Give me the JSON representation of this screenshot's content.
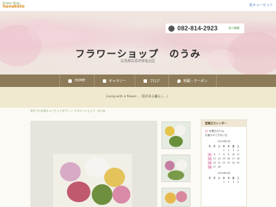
{
  "header": {
    "logo_top": "Flower Shop",
    "logo_brand": "hanakoto",
    "brand_right": "花キューピット",
    "tel": "082-814-2923",
    "recruit_label": "求人情報"
  },
  "hero": {
    "title": "フラワーショップ　のうみ",
    "subtitle": "広島県広島市安佐北区"
  },
  "nav": {
    "items": [
      {
        "label": "HOME",
        "icon": "home-icon"
      },
      {
        "label": "ギャラリー",
        "icon": "camera-icon"
      },
      {
        "label": "ブログ",
        "icon": "pencil-icon"
      },
      {
        "label": "地図・クーポン",
        "icon": "map-pin-icon"
      }
    ]
  },
  "tagline": "Living with a flower...（花のある暮らし...）",
  "breadcrumb": "花ギフトの花キューピットタウン ＞ フラワーショップ　のうみ",
  "calendar": {
    "title": "営業日カレンダー",
    "legend_holiday": "休業日または",
    "legend_note": "お届けのできない日",
    "month1": "2023年2月",
    "month2": "2023年3月",
    "dow": [
      "日",
      "月",
      "火",
      "水",
      "木",
      "金",
      "土"
    ],
    "feb": [
      "",
      "",
      "",
      "1",
      "2",
      "3",
      "4",
      "5",
      "6",
      "7",
      "8",
      "9",
      "10",
      "11",
      "12",
      "13",
      "14",
      "15",
      "16",
      "17",
      "18",
      "19",
      "20",
      "21",
      "22",
      "23",
      "24",
      "25",
      "26",
      "27",
      "28"
    ],
    "holidays_feb": [
      "5",
      "12",
      "19",
      "26"
    ],
    "mar": [
      "",
      "",
      "",
      "1",
      "2",
      "3",
      "4"
    ]
  },
  "colors": {
    "nav_bg": "#8c7a58",
    "tagline_bg": "#efe9cf",
    "holiday": "#f6cfe0"
  }
}
